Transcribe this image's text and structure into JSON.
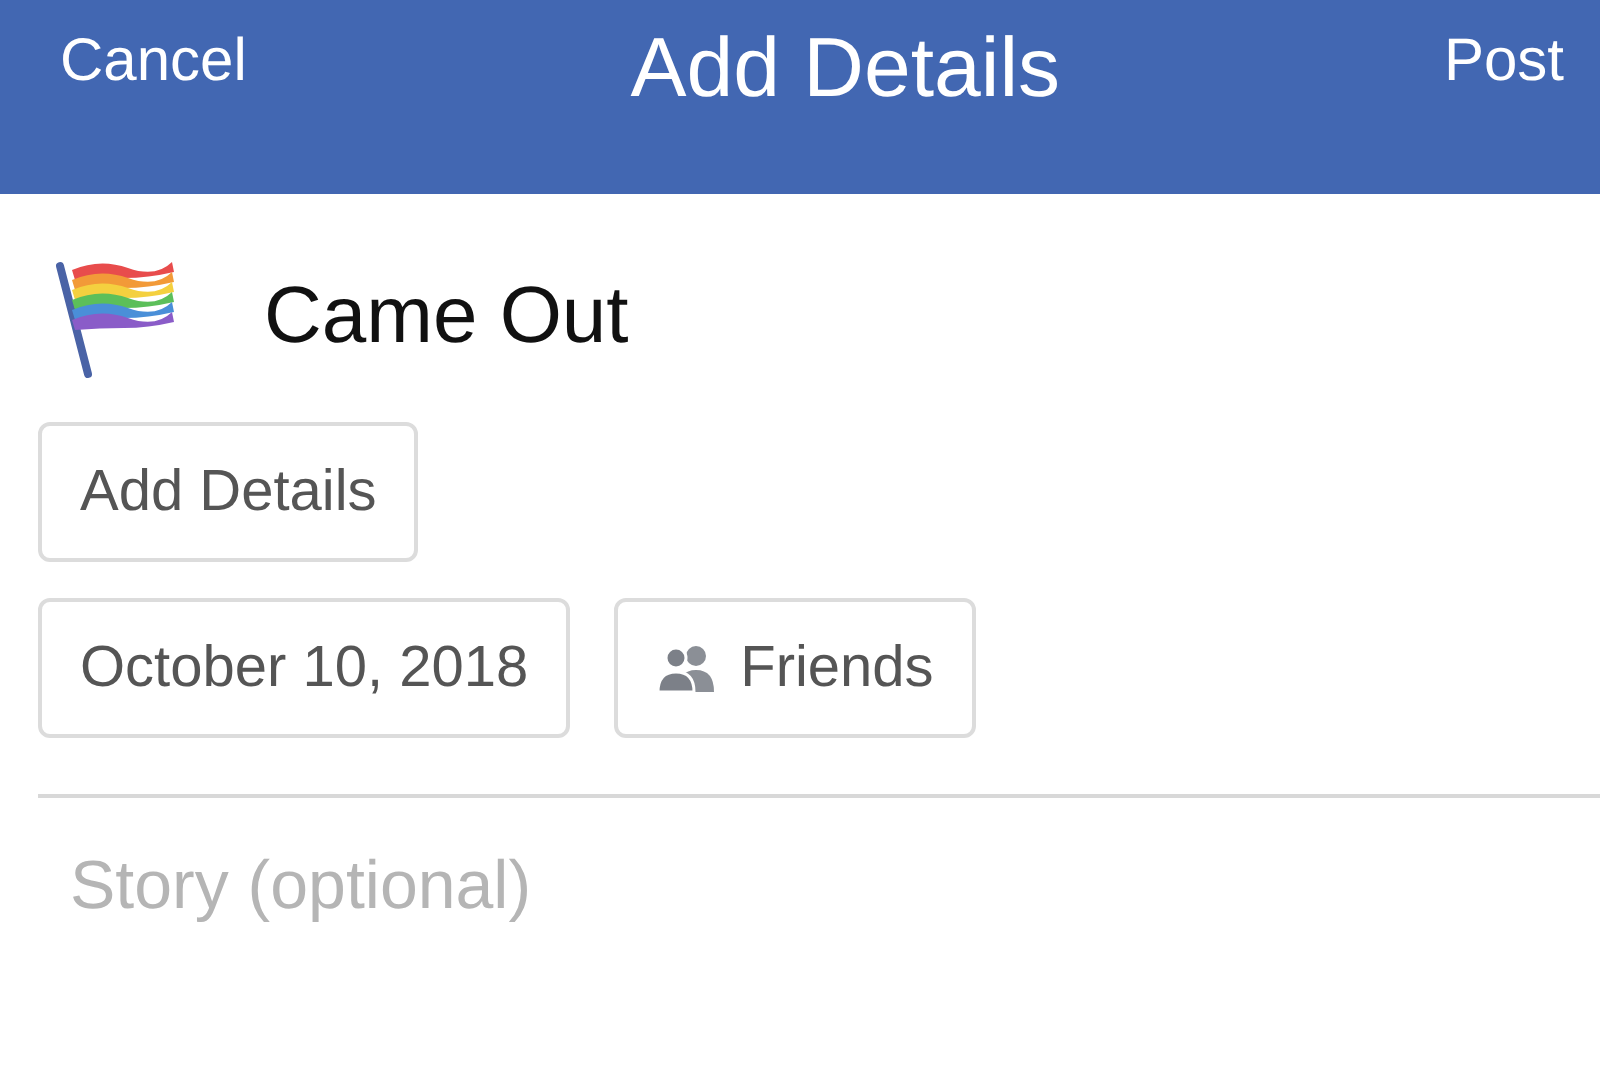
{
  "header": {
    "cancel": "Cancel",
    "title": "Add Details",
    "post": "Post"
  },
  "event": {
    "title": "Came Out"
  },
  "chips": [
    {
      "kind": "text",
      "label": "Add Details"
    },
    {
      "kind": "date",
      "label": "October 10, 2018"
    },
    {
      "kind": "audience",
      "label": "Friends"
    }
  ],
  "story": {
    "placeholder": "Story (optional)"
  }
}
